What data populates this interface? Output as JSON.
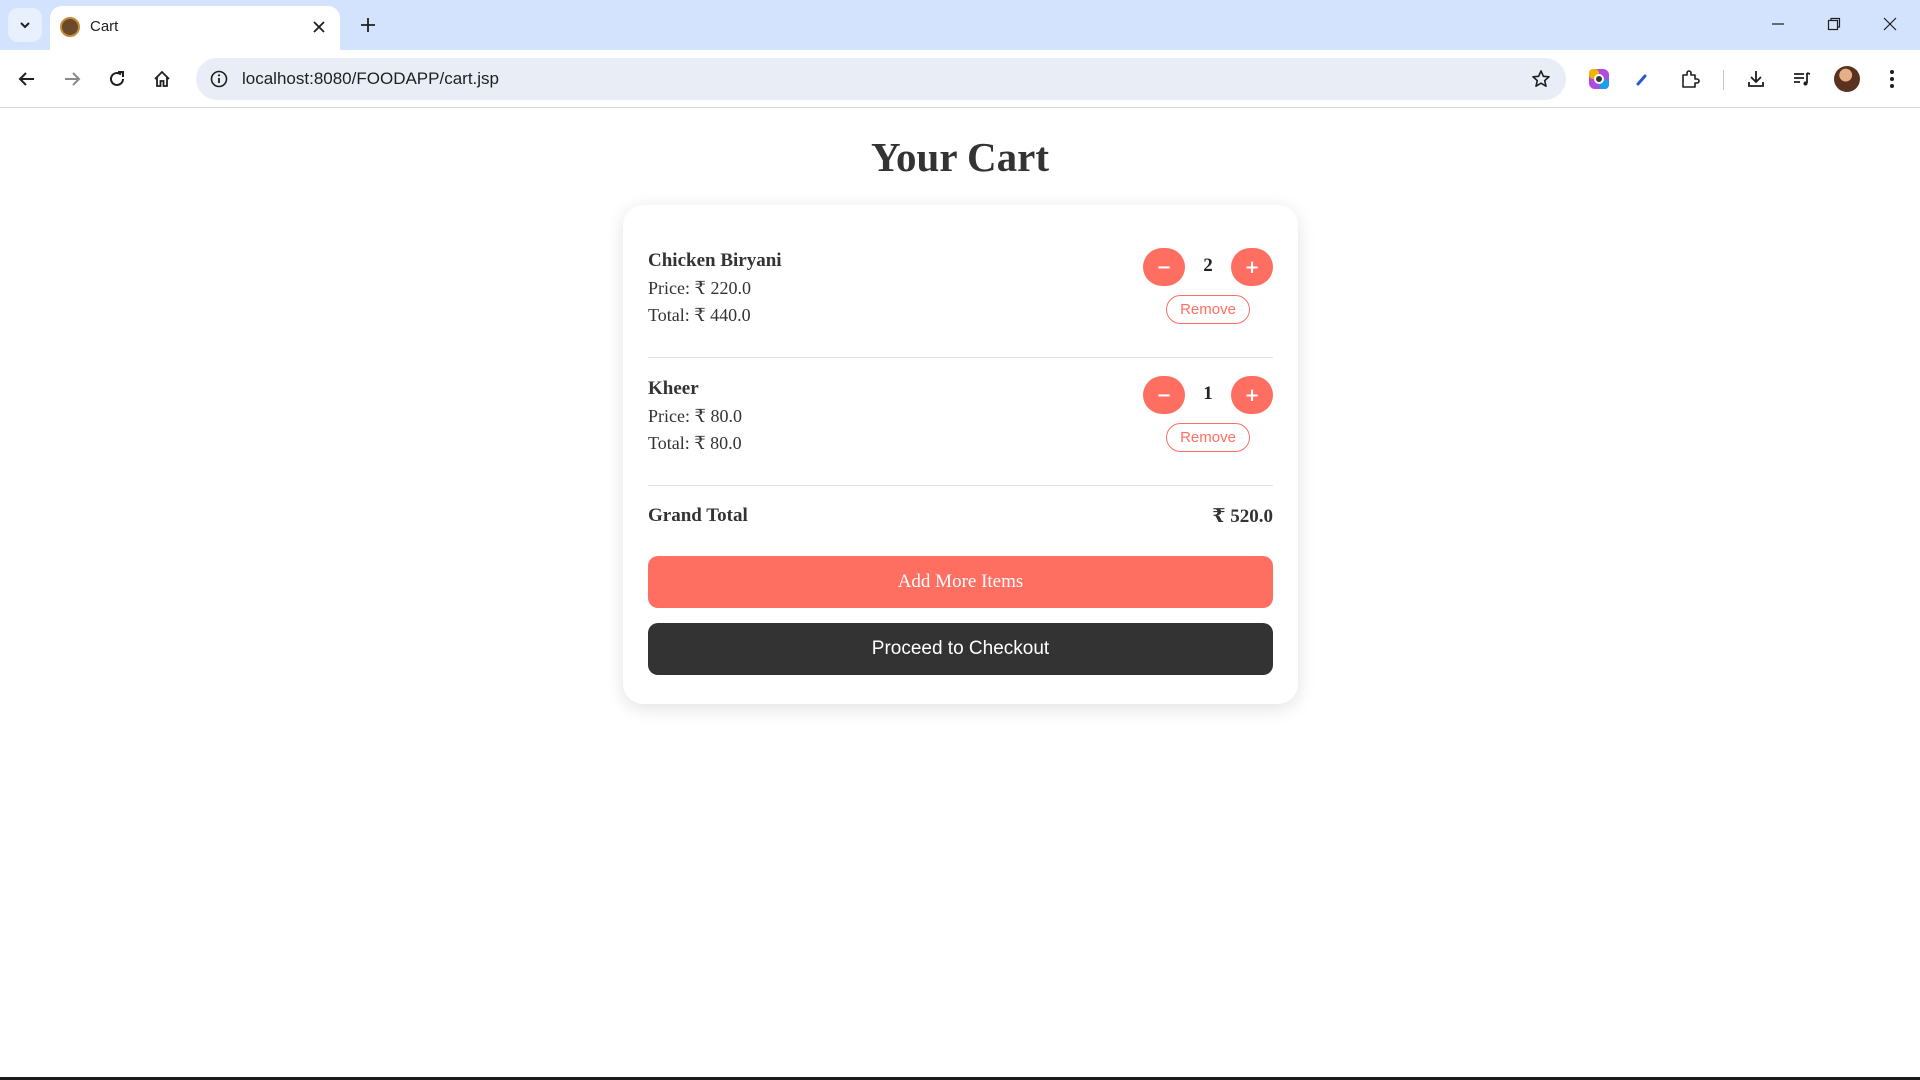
{
  "browser": {
    "tab_title": "Cart",
    "url": "localhost:8080/FOODAPP/cart.jsp",
    "icons": [
      "tab-search-icon",
      "favicon-icon",
      "close-icon",
      "plus-icon",
      "minimize-icon",
      "restore-icon",
      "window-close-icon",
      "back-icon",
      "forward-icon",
      "reload-icon",
      "home-icon",
      "info-icon",
      "star-icon",
      "color-extension-icon",
      "pen-extension-icon",
      "extensions-puzzle-icon",
      "download-icon",
      "media-queue-icon",
      "menu-dots-icon"
    ]
  },
  "page": {
    "title": "Your Cart"
  },
  "cart": {
    "items": [
      {
        "name": "Chicken Biryani",
        "price": "Price: ₹ 220.0",
        "total": "Total: ₹ 440.0",
        "quantity": "2",
        "minus_label": "−",
        "plus_label": "+",
        "remove_label": "Remove"
      },
      {
        "name": "Kheer",
        "price": "Price: ₹ 80.0",
        "total": "Total: ₹ 80.0",
        "quantity": "1",
        "minus_label": "−",
        "plus_label": "+",
        "remove_label": "Remove"
      }
    ],
    "grand_total_label": "Grand Total",
    "grand_total_value": "₹ 520.0",
    "add_more_label": "Add More Items",
    "checkout_label": "Proceed to Checkout"
  },
  "colors": {
    "accent": "#ff6f61",
    "dark_button": "#333333",
    "tabstrip": "#d3e3fd",
    "omnibox": "#e9eef6"
  }
}
